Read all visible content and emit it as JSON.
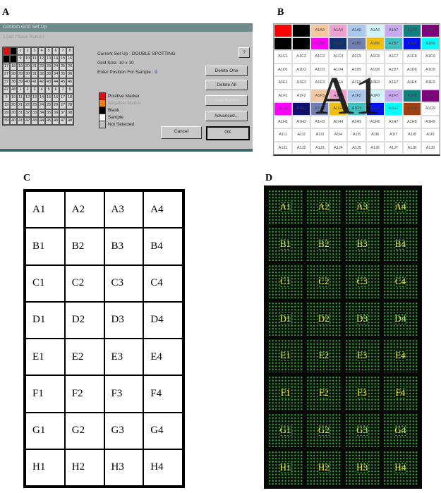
{
  "panel_labels": {
    "a": "A",
    "b": "B",
    "c": "C",
    "d": "D"
  },
  "panel_a": {
    "title": "Custom Grid Set Up",
    "subtitle": "Load / Save Pattern",
    "current_setup": "Current Set Up :  DOUBLE SPOTTING",
    "grid_size": "Grid Size:        10 x 10",
    "enter_position": "Enter Position For Sample :",
    "position_value": "9",
    "help_button": "?",
    "buttons": {
      "delete_one": "Delete One",
      "delete_all": "Delete All",
      "disabled": "Load Pattern",
      "advanced": "Advanced...",
      "cancel": "Cancel",
      "ok": "OK"
    },
    "legend": [
      {
        "label": "Positive Marker",
        "color": "#e01010"
      },
      {
        "label": "Negative Marker",
        "color": "#f08010"
      },
      {
        "label": "Blank",
        "color": "#000000"
      },
      {
        "label": "Sample",
        "color": "#ffffff"
      },
      {
        "label": "Not Selected",
        "color": "#c0c0c0"
      }
    ],
    "grid": [
      [
        "P",
        "B",
        "1",
        "2",
        "3",
        "4",
        "5",
        "6",
        "7",
        "8"
      ],
      [
        "B",
        "B",
        "9",
        "10",
        "11",
        "12",
        "13",
        "14",
        "15",
        "16"
      ],
      [
        "17",
        "18",
        "19",
        "20",
        "21",
        "22",
        "23",
        "24",
        "25",
        "26"
      ],
      [
        "27",
        "28",
        "29",
        "30",
        "31",
        "32",
        "33",
        "34",
        "35",
        "36"
      ],
      [
        "37",
        "38",
        "39",
        "40",
        "41",
        "42",
        "43",
        "44",
        "45",
        "46"
      ],
      [
        "47",
        "48",
        "1",
        "2",
        "3",
        "4",
        "5",
        "6",
        "7",
        "8"
      ],
      [
        "9",
        "10",
        "11",
        "12",
        "13",
        "14",
        "15",
        "16",
        "17",
        "18"
      ],
      [
        "19",
        "20",
        "21",
        "22",
        "23",
        "24",
        "25",
        "26",
        "27",
        "28"
      ],
      [
        "29",
        "30",
        "31",
        "32",
        "33",
        "34",
        "35",
        "36",
        "37",
        "38"
      ],
      [
        "39",
        "40",
        "41",
        "42",
        "43",
        "44",
        "45",
        "46",
        "47",
        "48"
      ]
    ]
  },
  "panel_b": {
    "overlay": "A1",
    "cells": [
      [
        [
          "",
          "#ff0000"
        ],
        [
          "",
          "#000000"
        ],
        [
          "A1A3",
          "#f5c8a0"
        ],
        [
          "A1A4",
          "#f0a0d0"
        ],
        [
          "A1A5",
          "#a8c8f0"
        ],
        [
          "A1A6",
          "#d0f4f8"
        ],
        [
          "A1A7",
          "#c8a8f0"
        ],
        [
          "A1A8",
          "#108080"
        ],
        [
          "A1A9",
          "#800080"
        ]
      ],
      [
        [
          "",
          "#000000"
        ],
        [
          "",
          "#000000"
        ],
        [
          "A1B3",
          "#ff00ff"
        ],
        [
          "A1B4",
          "#103070"
        ],
        [
          "A1B5",
          "#7080b0"
        ],
        [
          "A1B6",
          "#f0c010"
        ],
        [
          "A1B7",
          "#40c0c0"
        ],
        [
          "A1B8",
          "#0010f0"
        ],
        [
          "A1B9",
          "#00ffff"
        ]
      ],
      [
        [
          "A1C1",
          ""
        ],
        [
          "A1C2",
          ""
        ],
        [
          "A1C3",
          ""
        ],
        [
          "A1C4",
          ""
        ],
        [
          "A1C5",
          ""
        ],
        [
          "A1C6",
          ""
        ],
        [
          "A1C7",
          ""
        ],
        [
          "A1C8",
          ""
        ],
        [
          "A1C9",
          ""
        ]
      ],
      [
        [
          "A1D1",
          ""
        ],
        [
          "A1D2",
          ""
        ],
        [
          "A1D3",
          ""
        ],
        [
          "A1D4",
          ""
        ],
        [
          "A1D5",
          ""
        ],
        [
          "A1D6",
          ""
        ],
        [
          "A1D7",
          ""
        ],
        [
          "A1D8",
          ""
        ],
        [
          "A1D9",
          ""
        ]
      ],
      [
        [
          "A1E1",
          ""
        ],
        [
          "A1E2",
          ""
        ],
        [
          "A1E3",
          ""
        ],
        [
          "A1E4",
          ""
        ],
        [
          "A1E5",
          ""
        ],
        [
          "A1E6",
          ""
        ],
        [
          "A1E7",
          ""
        ],
        [
          "A1E8",
          ""
        ],
        [
          "A1E9",
          ""
        ]
      ],
      [
        [
          "A1F1",
          ""
        ],
        [
          "A1F2",
          ""
        ],
        [
          "A1F3",
          "#f5c8a0"
        ],
        [
          "A1F4",
          "#f0a0d0"
        ],
        [
          "A1F5",
          "#a8c8f0"
        ],
        [
          "A1F6",
          "#d0f4f8"
        ],
        [
          "A1F7",
          "#c8a8f0"
        ],
        [
          "A1F8",
          "#108080"
        ],
        [
          "A1F9",
          "#800080"
        ]
      ],
      [
        [
          "A1G1",
          "#ff00ff"
        ],
        [
          "A1G2",
          "#101070"
        ],
        [
          "A1G3",
          "#7080b0"
        ],
        [
          "A1G4",
          "#f0c010"
        ],
        [
          "A1G5",
          "#40c0c0"
        ],
        [
          "A1G6",
          "#0010f0"
        ],
        [
          "A1G7",
          "#00ffff"
        ],
        [
          "A1G8",
          "#a04010"
        ],
        [
          "A1G9",
          ""
        ]
      ],
      [
        [
          "A1H1",
          ""
        ],
        [
          "A1H2",
          ""
        ],
        [
          "A1H3",
          ""
        ],
        [
          "A1H4",
          ""
        ],
        [
          "A1H5",
          ""
        ],
        [
          "A1H6",
          ""
        ],
        [
          "A1H7",
          ""
        ],
        [
          "A1H8",
          ""
        ],
        [
          "A1H9",
          ""
        ]
      ],
      [
        [
          "A1I1",
          ""
        ],
        [
          "A1I2",
          ""
        ],
        [
          "A1I3",
          ""
        ],
        [
          "A1I4",
          ""
        ],
        [
          "A1I5",
          ""
        ],
        [
          "A1I6",
          ""
        ],
        [
          "A1I7",
          ""
        ],
        [
          "A1I8",
          ""
        ],
        [
          "A1I9",
          ""
        ]
      ],
      [
        [
          "A1J1",
          ""
        ],
        [
          "A1J2",
          ""
        ],
        [
          "A1J3",
          ""
        ],
        [
          "A1J4",
          ""
        ],
        [
          "A1J5",
          ""
        ],
        [
          "A1J6",
          ""
        ],
        [
          "A1J7",
          ""
        ],
        [
          "A1J8",
          ""
        ],
        [
          "A1J9",
          ""
        ]
      ]
    ]
  },
  "panel_c": {
    "cells": [
      [
        "A1",
        "A2",
        "A3",
        "A4"
      ],
      [
        "B1",
        "B2",
        "B3",
        "B4"
      ],
      [
        "C1",
        "C2",
        "C3",
        "C4"
      ],
      [
        "D1",
        "D2",
        "D3",
        "D4"
      ],
      [
        "E1",
        "E2",
        "E3",
        "E4"
      ],
      [
        "F1",
        "F2",
        "F3",
        "F4"
      ],
      [
        "G1",
        "G2",
        "G3",
        "G4"
      ],
      [
        "H1",
        "H2",
        "H3",
        "H4"
      ]
    ]
  },
  "panel_d": {
    "label_color": "#e8e830",
    "spot_color": "#3aa83a",
    "cells": [
      [
        "A1",
        "A2",
        "A3",
        "A4"
      ],
      [
        "B1",
        "B2",
        "B3",
        "B4"
      ],
      [
        "C1",
        "C2",
        "C3",
        "C4"
      ],
      [
        "D1",
        "D2",
        "D3",
        "D4"
      ],
      [
        "E1",
        "E2",
        "E3",
        "E4"
      ],
      [
        "F1",
        "F2",
        "F3",
        "F4"
      ],
      [
        "G1",
        "G2",
        "G3",
        "G4"
      ],
      [
        "H1",
        "H2",
        "H3",
        "H4"
      ]
    ]
  }
}
